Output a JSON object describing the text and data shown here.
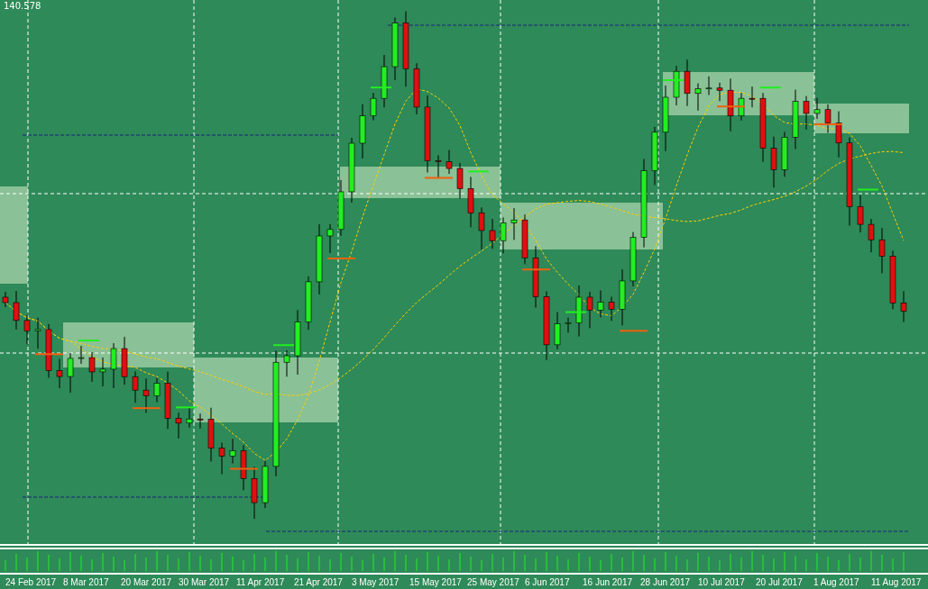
{
  "chart": {
    "price_label": "140.578"
  },
  "x_axis": {
    "labels": [
      "24 Feb 2017",
      "8 Mar 2017",
      "20 Mar 2017",
      "30 Mar 2017",
      "11 Apr 2017",
      "21 Apr 2017",
      "3 May 2017",
      "15 May 2017",
      "25 May 2017",
      "6 Jun 2017",
      "16 Jun 2017",
      "28 Jun 2017",
      "10 Jul 2017",
      "20 Jul 2017",
      "1 Aug 2017",
      "11 Aug 2017"
    ]
  }
}
